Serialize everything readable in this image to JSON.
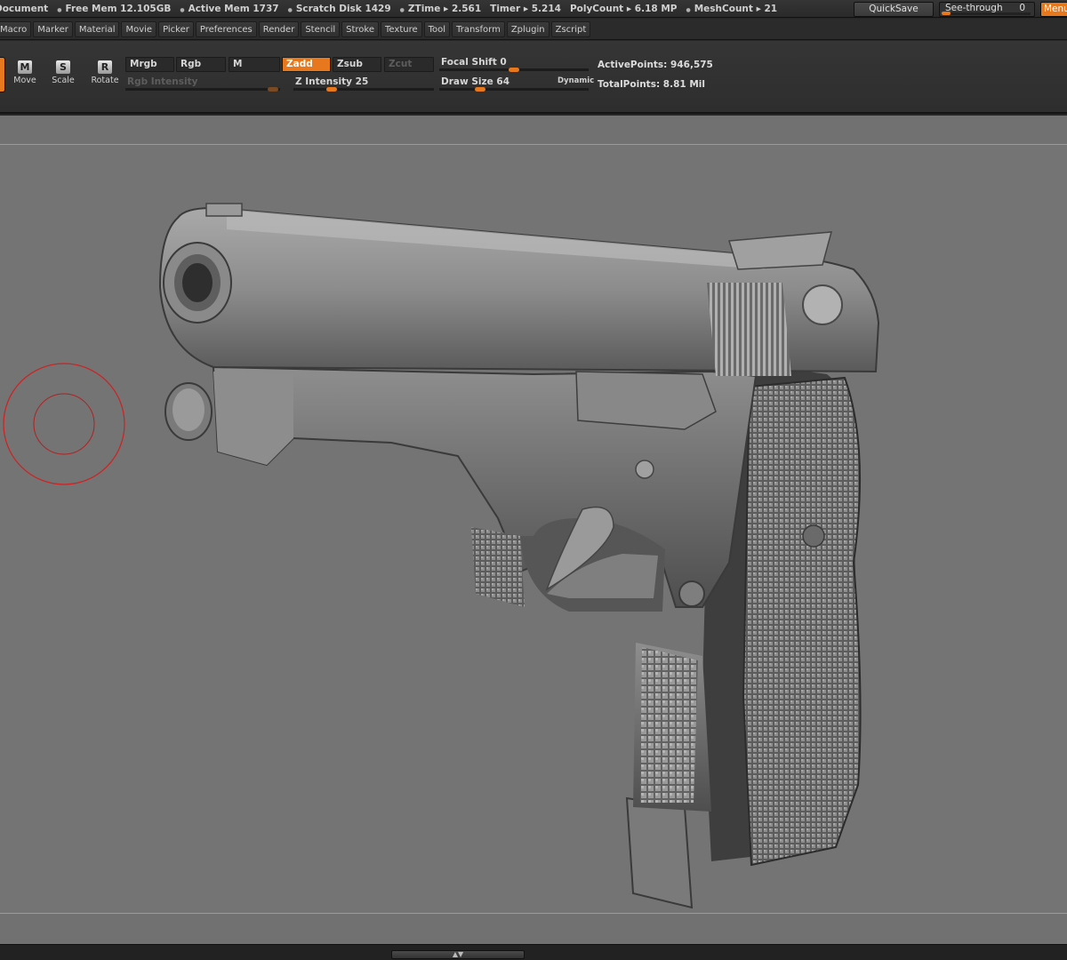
{
  "status": {
    "items": [
      {
        "bullet": false,
        "label": "Document"
      },
      {
        "bullet": true,
        "label": "Free Mem 12.105GB"
      },
      {
        "bullet": true,
        "label": "Active Mem 1737"
      },
      {
        "bullet": true,
        "label": "Scratch Disk 1429"
      },
      {
        "bullet": true,
        "label": "ZTime ▸ 2.561"
      },
      {
        "bullet": false,
        "label": "Timer ▸ 5.214"
      },
      {
        "bullet": false,
        "label": "PolyCount ▸ 6.18 MP"
      },
      {
        "bullet": true,
        "label": "MeshCount ▸ 21"
      }
    ],
    "quicksave": "QuickSave",
    "see_through_label": "See-through",
    "see_through_value": "0",
    "see_through_level": 0,
    "menus_label": "Menus"
  },
  "menu": [
    "Macro",
    "Marker",
    "Material",
    "Movie",
    "Picker",
    "Preferences",
    "Render",
    "Stencil",
    "Stroke",
    "Texture",
    "Tool",
    "Transform",
    "Zplugin",
    "Zscript"
  ],
  "shelf": {
    "move": {
      "glyph": "M",
      "label": "Move"
    },
    "scale": {
      "glyph": "S",
      "label": "Scale"
    },
    "rotate": {
      "glyph": "R",
      "label": "Rotate"
    },
    "mrgb": "Mrgb",
    "rgb": "Rgb",
    "m": "M",
    "zadd": "Zadd",
    "zsub": "Zsub",
    "zcut": "Zcut",
    "rgb_intensity": "Rgb Intensity",
    "z_intensity_label": "Z Intensity",
    "z_intensity_value": "25",
    "focal_shift_label": "Focal Shift",
    "focal_shift_value": "0",
    "draw_size_label": "Draw Size",
    "draw_size_value": "64",
    "dynamic": "Dynamic",
    "active_points": "ActivePoints: 946,575",
    "total_points": "TotalPoints: 8.81 Mil"
  },
  "colors": {
    "accent": "#e8781e",
    "canvas": "#747474",
    "brush_cursor": "#d02020"
  }
}
